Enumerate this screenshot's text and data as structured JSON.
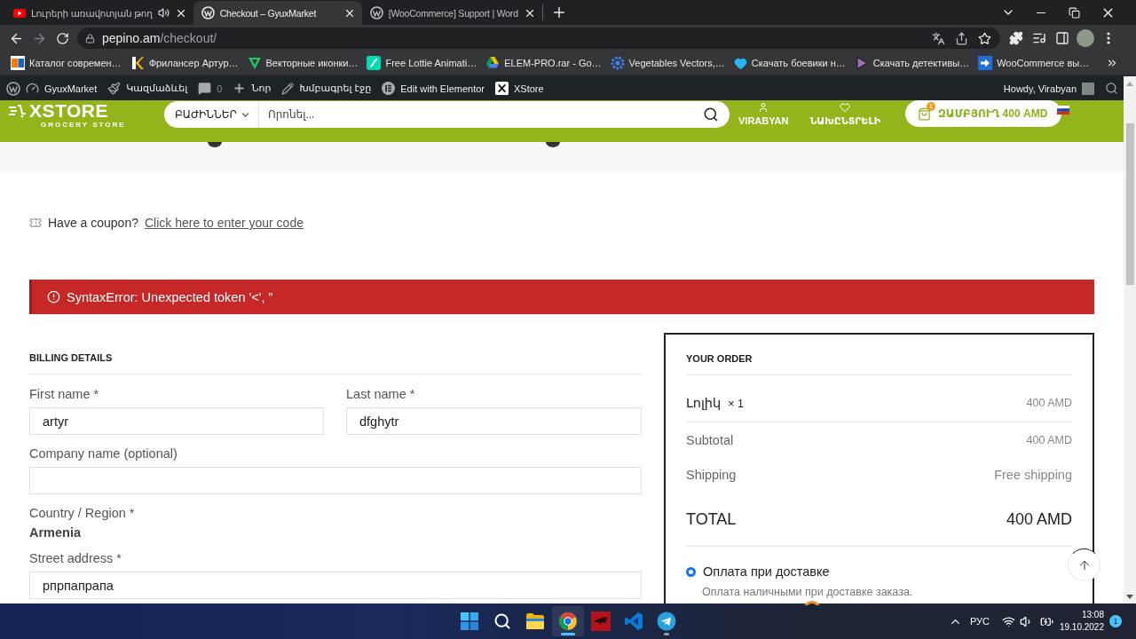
{
  "browser": {
    "tabs": [
      {
        "title": "Լուրերի առավոտյան թող",
        "selected": false,
        "audio": true
      },
      {
        "title": "Checkout – GyuxMarket",
        "selected": true,
        "audio": false
      },
      {
        "title": "[WooCommerce] Support | Word",
        "selected": false,
        "audio": false
      }
    ],
    "nav": {
      "forward_disabled": true
    },
    "address": {
      "host": "pepino.am",
      "path": "/checkout/"
    },
    "bookmarks": [
      "Каталог современ…",
      "Фрилансер Артур…",
      "Векторные иконки…",
      "Free Lottie Animati…",
      "ELEM-PRO.rar - Go…",
      "Vegetables Vectors,…",
      "Скачать боевики н…",
      "Скачать детективы…",
      "WooCommerce вы…"
    ]
  },
  "admin_bar": {
    "items": [
      {
        "kind": "site",
        "label": "GyuxMarket"
      },
      {
        "kind": "customize",
        "label": "Կազմաձևել"
      },
      {
        "kind": "comments",
        "label": "0"
      },
      {
        "kind": "new",
        "label": "Նոր"
      },
      {
        "kind": "edit",
        "label": "Խմբագրել էջը"
      },
      {
        "kind": "elementor",
        "label": "Edit with Elementor"
      },
      {
        "kind": "xstore",
        "label": "XStore"
      }
    ],
    "greeting": "Howdy, Virabyan"
  },
  "header": {
    "logo": {
      "name": "XSTORE",
      "tagline": "GROCERY STORE"
    },
    "search": {
      "category": "ԲԱԺԻՆՆԵՐ",
      "placeholder": "Որոնել..."
    },
    "account": "VIRABYAN",
    "wishlist": "ՆԱԽԸՆՏՐԵԼԻ",
    "cart": {
      "label": "ԶԱՄԲՅՈՒՂ",
      "total": "400 AMD",
      "count": "1"
    }
  },
  "coupon": {
    "prompt": "Have a coupon?",
    "link": "Click here to enter your code"
  },
  "notice": {
    "message": "SyntaxError: Unexpected token '<', \""
  },
  "billing": {
    "title": "BILLING DETAILS",
    "fields": [
      {
        "kind": "input",
        "label": "First name *",
        "value": "artyr"
      },
      {
        "kind": "input",
        "label": "Last name *",
        "value": "dfghytr"
      },
      {
        "kind": "input",
        "label": "Company name (optional)"
      },
      {
        "kind": "static",
        "label": "Country / Region *",
        "value": "Armenia"
      },
      {
        "kind": "input",
        "label": "Street address *",
        "value": "рпрпапрапа"
      }
    ]
  },
  "order": {
    "title": "YOUR ORDER",
    "items": [
      {
        "name": "Լոլիկ",
        "quantity": "× 1",
        "price": "400 AMD"
      }
    ],
    "subtotal": {
      "label": "Subtotal",
      "value": "400 AMD"
    },
    "shipping": {
      "label": "Shipping",
      "value": "Free shipping"
    },
    "total": {
      "label": "TOTAL",
      "value": "400 AMD"
    },
    "payment_methods": [
      {
        "label": "Оплата при доставке",
        "description": "Оплата наличными при доставке заказа.",
        "selected": true
      }
    ]
  },
  "taskbar": {
    "apps": [
      {
        "active": false,
        "running": false
      },
      {
        "active": true,
        "running": true
      },
      {
        "active": false,
        "running": false
      },
      {
        "active": false,
        "running": false
      },
      {
        "active": false,
        "running": true
      }
    ],
    "language": "РУС",
    "time": "13:08",
    "date": "19.10.2022",
    "notifications": "1"
  }
}
